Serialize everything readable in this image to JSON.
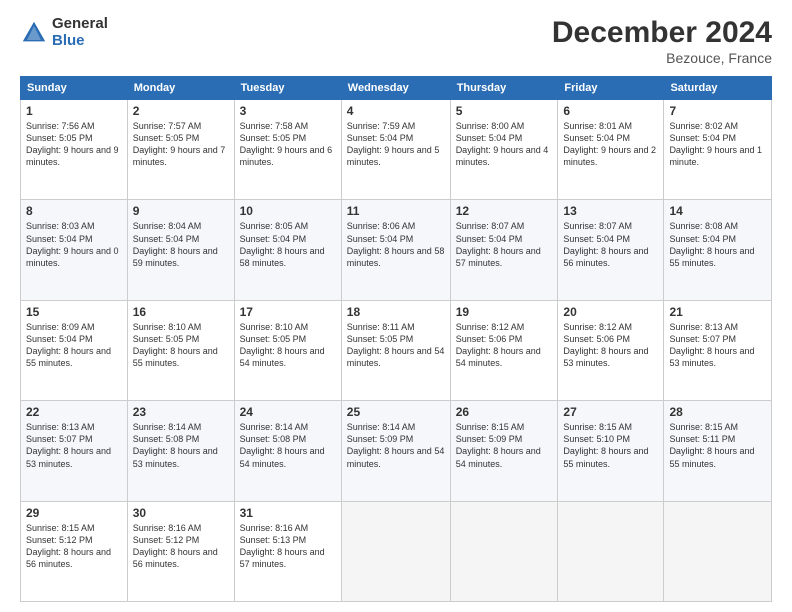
{
  "header": {
    "logo_general": "General",
    "logo_blue": "Blue",
    "month_title": "December 2024",
    "subtitle": "Bezouce, France"
  },
  "days_of_week": [
    "Sunday",
    "Monday",
    "Tuesday",
    "Wednesday",
    "Thursday",
    "Friday",
    "Saturday"
  ],
  "weeks": [
    [
      {
        "day": "1",
        "info": "Sunrise: 7:56 AM\nSunset: 5:05 PM\nDaylight: 9 hours and 9 minutes."
      },
      {
        "day": "2",
        "info": "Sunrise: 7:57 AM\nSunset: 5:05 PM\nDaylight: 9 hours and 7 minutes."
      },
      {
        "day": "3",
        "info": "Sunrise: 7:58 AM\nSunset: 5:05 PM\nDaylight: 9 hours and 6 minutes."
      },
      {
        "day": "4",
        "info": "Sunrise: 7:59 AM\nSunset: 5:04 PM\nDaylight: 9 hours and 5 minutes."
      },
      {
        "day": "5",
        "info": "Sunrise: 8:00 AM\nSunset: 5:04 PM\nDaylight: 9 hours and 4 minutes."
      },
      {
        "day": "6",
        "info": "Sunrise: 8:01 AM\nSunset: 5:04 PM\nDaylight: 9 hours and 2 minutes."
      },
      {
        "day": "7",
        "info": "Sunrise: 8:02 AM\nSunset: 5:04 PM\nDaylight: 9 hours and 1 minute."
      }
    ],
    [
      {
        "day": "8",
        "info": "Sunrise: 8:03 AM\nSunset: 5:04 PM\nDaylight: 9 hours and 0 minutes."
      },
      {
        "day": "9",
        "info": "Sunrise: 8:04 AM\nSunset: 5:04 PM\nDaylight: 8 hours and 59 minutes."
      },
      {
        "day": "10",
        "info": "Sunrise: 8:05 AM\nSunset: 5:04 PM\nDaylight: 8 hours and 58 minutes."
      },
      {
        "day": "11",
        "info": "Sunrise: 8:06 AM\nSunset: 5:04 PM\nDaylight: 8 hours and 58 minutes."
      },
      {
        "day": "12",
        "info": "Sunrise: 8:07 AM\nSunset: 5:04 PM\nDaylight: 8 hours and 57 minutes."
      },
      {
        "day": "13",
        "info": "Sunrise: 8:07 AM\nSunset: 5:04 PM\nDaylight: 8 hours and 56 minutes."
      },
      {
        "day": "14",
        "info": "Sunrise: 8:08 AM\nSunset: 5:04 PM\nDaylight: 8 hours and 55 minutes."
      }
    ],
    [
      {
        "day": "15",
        "info": "Sunrise: 8:09 AM\nSunset: 5:04 PM\nDaylight: 8 hours and 55 minutes."
      },
      {
        "day": "16",
        "info": "Sunrise: 8:10 AM\nSunset: 5:05 PM\nDaylight: 8 hours and 55 minutes."
      },
      {
        "day": "17",
        "info": "Sunrise: 8:10 AM\nSunset: 5:05 PM\nDaylight: 8 hours and 54 minutes."
      },
      {
        "day": "18",
        "info": "Sunrise: 8:11 AM\nSunset: 5:05 PM\nDaylight: 8 hours and 54 minutes."
      },
      {
        "day": "19",
        "info": "Sunrise: 8:12 AM\nSunset: 5:06 PM\nDaylight: 8 hours and 54 minutes."
      },
      {
        "day": "20",
        "info": "Sunrise: 8:12 AM\nSunset: 5:06 PM\nDaylight: 8 hours and 53 minutes."
      },
      {
        "day": "21",
        "info": "Sunrise: 8:13 AM\nSunset: 5:07 PM\nDaylight: 8 hours and 53 minutes."
      }
    ],
    [
      {
        "day": "22",
        "info": "Sunrise: 8:13 AM\nSunset: 5:07 PM\nDaylight: 8 hours and 53 minutes."
      },
      {
        "day": "23",
        "info": "Sunrise: 8:14 AM\nSunset: 5:08 PM\nDaylight: 8 hours and 53 minutes."
      },
      {
        "day": "24",
        "info": "Sunrise: 8:14 AM\nSunset: 5:08 PM\nDaylight: 8 hours and 54 minutes."
      },
      {
        "day": "25",
        "info": "Sunrise: 8:14 AM\nSunset: 5:09 PM\nDaylight: 8 hours and 54 minutes."
      },
      {
        "day": "26",
        "info": "Sunrise: 8:15 AM\nSunset: 5:09 PM\nDaylight: 8 hours and 54 minutes."
      },
      {
        "day": "27",
        "info": "Sunrise: 8:15 AM\nSunset: 5:10 PM\nDaylight: 8 hours and 55 minutes."
      },
      {
        "day": "28",
        "info": "Sunrise: 8:15 AM\nSunset: 5:11 PM\nDaylight: 8 hours and 55 minutes."
      }
    ],
    [
      {
        "day": "29",
        "info": "Sunrise: 8:15 AM\nSunset: 5:12 PM\nDaylight: 8 hours and 56 minutes."
      },
      {
        "day": "30",
        "info": "Sunrise: 8:16 AM\nSunset: 5:12 PM\nDaylight: 8 hours and 56 minutes."
      },
      {
        "day": "31",
        "info": "Sunrise: 8:16 AM\nSunset: 5:13 PM\nDaylight: 8 hours and 57 minutes."
      },
      null,
      null,
      null,
      null
    ]
  ]
}
